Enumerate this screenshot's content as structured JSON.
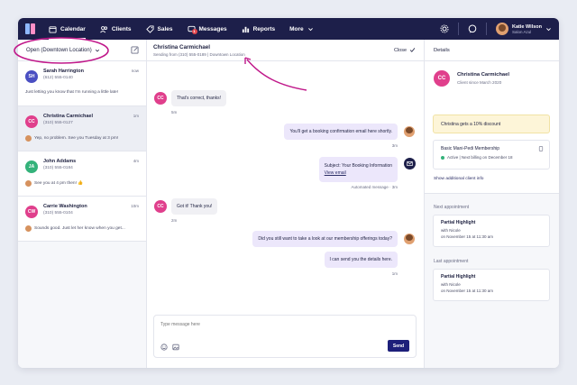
{
  "nav": {
    "items": [
      {
        "label": "Calendar",
        "icon": "calendar-icon"
      },
      {
        "label": "Clients",
        "icon": "clients-icon"
      },
      {
        "label": "Sales",
        "icon": "tag-icon"
      },
      {
        "label": "Messages",
        "icon": "messages-icon",
        "badge": "1"
      },
      {
        "label": "Reports",
        "icon": "reports-icon"
      },
      {
        "label": "More",
        "icon": "chevron-down-icon"
      }
    ],
    "user_name": "Katie Wilson",
    "user_sub": "Salon Azul"
  },
  "list": {
    "filter_label": "Open (Downtown Location)",
    "conversations": [
      {
        "initials": "SH",
        "name": "Sarah Harrington",
        "phone": "(612) 555-0140",
        "time": "now",
        "snippet": "Just letting you know that I'm running a little late!",
        "color": "#4a4fc2"
      },
      {
        "initials": "CC",
        "name": "Christina Carmichael",
        "phone": "(310) 555-0127",
        "time": "1m",
        "snippet": "Yep, no problem. See you Tuesday at 3 pm!",
        "color": "#e03f8c"
      },
      {
        "initials": "JA",
        "name": "John Addams",
        "phone": "(310) 555-0184",
        "time": "4m",
        "snippet": "See you at 4 pm then! 👍",
        "color": "#34b27a"
      },
      {
        "initials": "CW",
        "name": "Carrie Washington",
        "phone": "(310) 555-0104",
        "time": "10m",
        "snippet": "Sounds good. Just let her know when you get...",
        "color": "#e03f8c"
      }
    ]
  },
  "chat": {
    "title": "Christina Carmichael",
    "subtitle": "Sending from (310) 555-0189 | Downtown Location",
    "close_label": "Close",
    "messages": [
      {
        "text": "That's correct, thanks!",
        "meta": "5m"
      },
      {
        "text": "You'll get a booking confirmation email here shortly.",
        "meta": "3m"
      },
      {
        "text": "Subject: Your Booking Information",
        "link": "View email",
        "meta": "Automated message · 3m"
      },
      {
        "text": "Got it! Thank you!",
        "meta": "2m"
      },
      {
        "text": "Did you still want to take a look at our membership offerings today?",
        "meta": ""
      },
      {
        "text": "I can send you the details here.",
        "meta": "1m"
      }
    ],
    "input_placeholder": "Type message here",
    "send_label": "Send"
  },
  "details": {
    "header": "Details",
    "client_initials": "CC",
    "client_name": "Christina Carmichael",
    "client_since": "Client since March 2020",
    "promo": "Christina gets a 10% discount",
    "membership_name": "Basic Mani-Pedi Membership",
    "membership_status": "Active | Next billing on December 18",
    "show_info_link": "Show additional client info",
    "next_label": "Next appointment",
    "next_service": "Partial Highlight",
    "next_with": "with Nicole",
    "next_when": "on November 15 at 11:30 am",
    "last_label": "Last appointment",
    "last_service": "Partial Highlight",
    "last_with": "with Nicole",
    "last_when": "on November 15 at 11:30 am"
  },
  "colors": {
    "nav_bg": "#1d1f4a",
    "accent_pink": "#e03f8c",
    "annotation": "#c0188a",
    "send_button": "#1d1f7a"
  }
}
